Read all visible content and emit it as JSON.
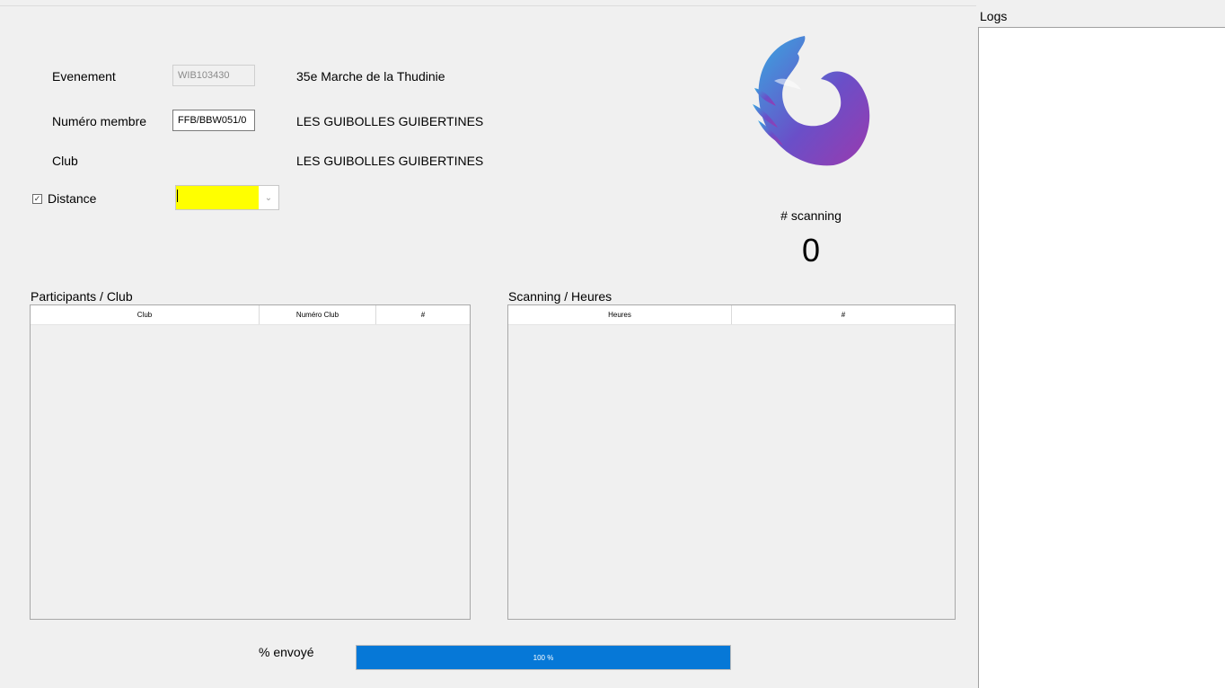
{
  "form": {
    "evenement_label": "Evenement",
    "evenement_code": "WIB103430",
    "evenement_name": "35e Marche de la Thudinie",
    "membre_label": "Numéro membre",
    "membre_value": "FFB/BBW051/0",
    "membre_name": "LES GUIBOLLES GUIBERTINES",
    "club_label": "Club",
    "club_value": "LES GUIBOLLES GUIBERTINES",
    "distance_label": "Distance",
    "distance_value": "",
    "distance_checked": true,
    "distance_highlight": "#ffff00"
  },
  "logo": {
    "icon": "bird-logo-icon",
    "colors": [
      "#3a9ad9",
      "#6b4bc7",
      "#9b3bb0"
    ]
  },
  "scanning": {
    "label": "# scanning",
    "count": "0"
  },
  "participants": {
    "title": "Participants / Club",
    "columns": [
      "Club",
      "Numéro Club",
      "#"
    ],
    "rows": []
  },
  "heures": {
    "title": "Scanning / Heures",
    "columns": [
      "Heures",
      "#"
    ],
    "rows": []
  },
  "progress": {
    "label": "% envoyé",
    "percent": 100,
    "text": "100 %",
    "color": "#0678d7"
  },
  "logs": {
    "title": "Logs",
    "entries": []
  }
}
